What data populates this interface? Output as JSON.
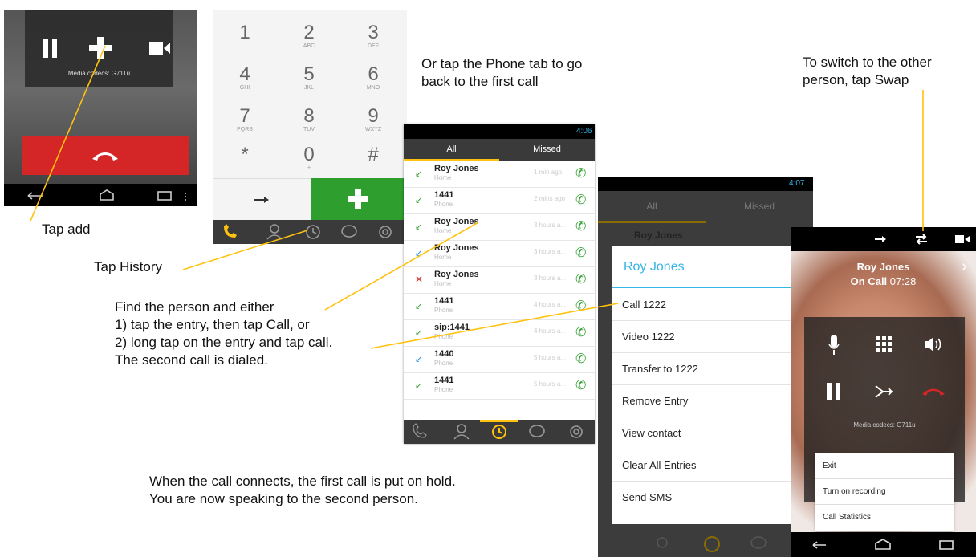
{
  "captions": {
    "tap_add": "Tap add",
    "tap_history": "Tap History",
    "phone_tab": "Or tap the Phone tab to go\nback to the first call",
    "swap": "To switch to the other\nperson, tap Swap",
    "find_person": "Find the person and either\n1) tap the entry, then tap Call, or\n2) long tap on the entry and tap call.\nThe second call is dialed.",
    "connects": "When the call connects, the first call is put on hold.\nYou are now speaking to the second person."
  },
  "screen1": {
    "codec": "Media codecs: G711u"
  },
  "dialpad": {
    "keys": [
      {
        "digit": "1",
        "letters": ""
      },
      {
        "digit": "2",
        "letters": "ABC"
      },
      {
        "digit": "3",
        "letters": "DEF"
      },
      {
        "digit": "4",
        "letters": "GHI"
      },
      {
        "digit": "5",
        "letters": "JKL"
      },
      {
        "digit": "6",
        "letters": "MNO"
      },
      {
        "digit": "7",
        "letters": "PQRS"
      },
      {
        "digit": "8",
        "letters": "TUV"
      },
      {
        "digit": "9",
        "letters": "WXYZ"
      },
      {
        "digit": "*",
        "letters": ""
      },
      {
        "digit": "0",
        "letters": "+"
      },
      {
        "digit": "#",
        "letters": ""
      }
    ]
  },
  "history": {
    "time": "4:06",
    "tabs": [
      "All",
      "Missed"
    ],
    "rows": [
      {
        "name": "Roy Jones",
        "type": "Home",
        "time": "1 min ago"
      },
      {
        "name": "1441",
        "type": "Phone",
        "time": "2 mins ago"
      },
      {
        "name": "Roy Jones",
        "type": "Home",
        "time": "3 hours a..."
      },
      {
        "name": "Roy Jones",
        "type": "Home",
        "time": "3 hours a..."
      },
      {
        "name": "Roy Jones",
        "type": "Home",
        "time": "3 hours a..."
      },
      {
        "name": "1441",
        "type": "Phone",
        "time": "4 hours a..."
      },
      {
        "name": "sip:1441",
        "type": "Phone",
        "time": "4 hours a..."
      },
      {
        "name": "1440",
        "type": "Phone",
        "time": "5 hours a..."
      },
      {
        "name": "1441",
        "type": "Phone",
        "time": "5 hours a..."
      }
    ]
  },
  "context": {
    "time": "4:07",
    "tabs": [
      "All",
      "Missed"
    ],
    "behind_name": "Roy Jones",
    "title": "Roy Jones",
    "items": [
      "Call 1222",
      "Video 1222",
      "Transfer to 1222",
      "Remove Entry",
      "View contact",
      "Clear All Entries",
      "Send SMS"
    ]
  },
  "call2": {
    "name": "Roy Jones",
    "status": "On Call",
    "duration": "07:28",
    "codec": "Media codecs: G711u",
    "menu": [
      "Exit",
      "Turn on recording",
      "Call Statistics"
    ]
  },
  "colors": {
    "green": "#2e9e2e",
    "red": "#d42626",
    "yellow": "#ffc20e",
    "blue": "#33b5e5"
  }
}
